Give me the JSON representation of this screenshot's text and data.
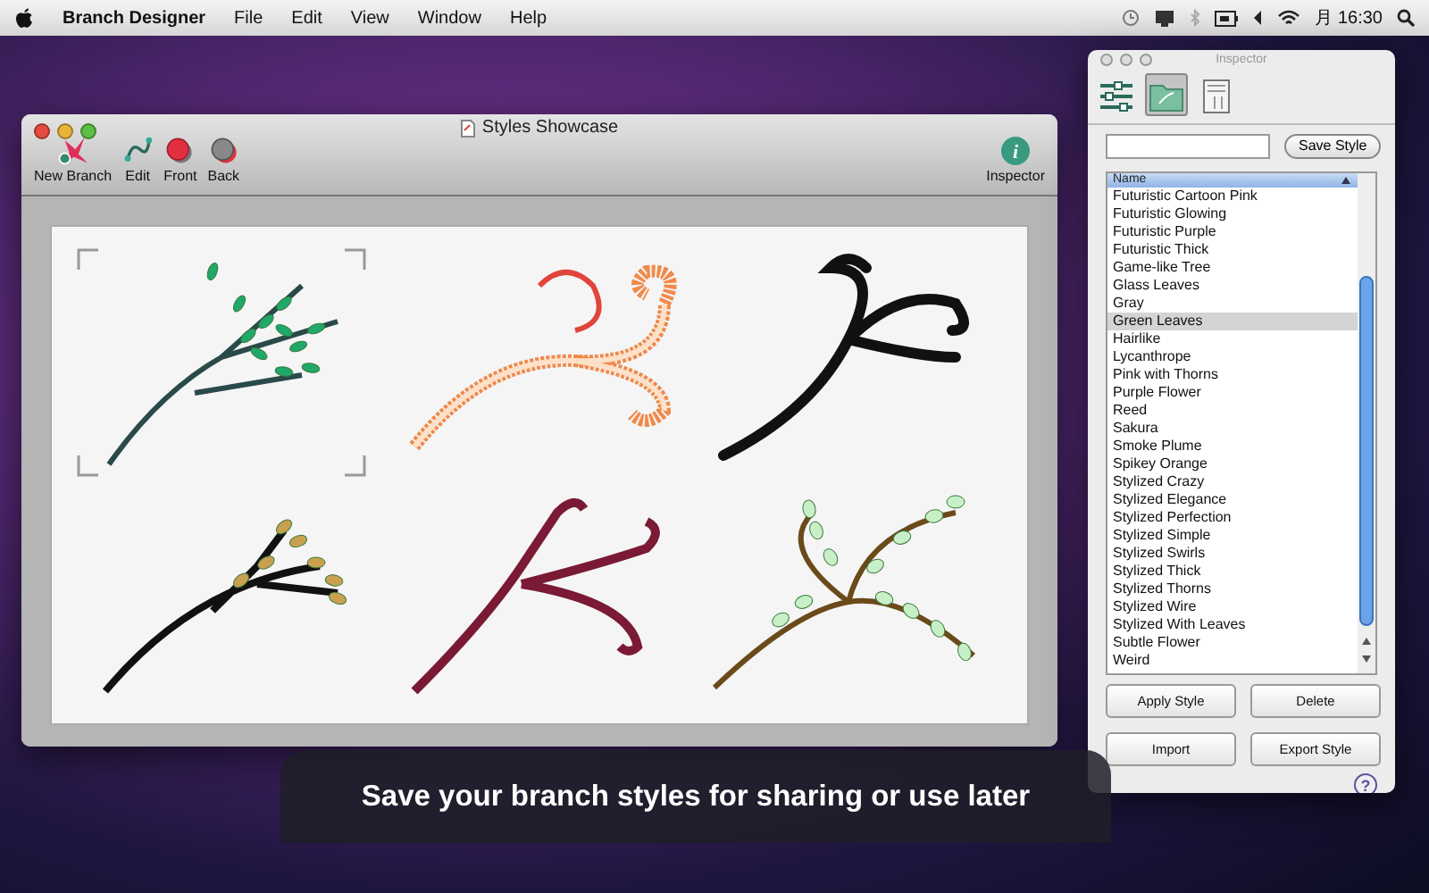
{
  "menu_bar": {
    "app_name": "Branch Designer",
    "menus": [
      "File",
      "Edit",
      "View",
      "Window",
      "Help"
    ],
    "clock": "月 16:30"
  },
  "document_window": {
    "title": "Styles Showcase",
    "toolbar": [
      {
        "label": "New Branch",
        "kind": "new"
      },
      {
        "label": "Edit",
        "kind": "edit"
      },
      {
        "label": "Front",
        "kind": "front"
      },
      {
        "label": "Back",
        "kind": "back"
      }
    ],
    "inspector_button": "Inspector",
    "inspector_icon_glyph": "i",
    "branches": [
      {
        "kind": "leafy",
        "color": "#1fa86a",
        "selected": true
      },
      {
        "kind": "flame",
        "color": "#f08a4a",
        "selected": false
      },
      {
        "kind": "curly",
        "color": "#111111",
        "selected": false
      },
      {
        "kind": "buds",
        "color": "#c8a050",
        "selected": false
      },
      {
        "kind": "thorny",
        "color": "#7a1a35",
        "selected": false
      },
      {
        "kind": "vine",
        "color": "#6b4a1a",
        "selected": false
      }
    ]
  },
  "inspector": {
    "title": "Inspector",
    "tabs": [
      {
        "kind": "sliders",
        "selected": false
      },
      {
        "kind": "folder",
        "selected": true
      },
      {
        "kind": "page",
        "selected": false
      }
    ],
    "save_button": "Save Style",
    "column_header": "Name",
    "styles": [
      {
        "name": "Futuristic Cartoon Pink",
        "selected": false
      },
      {
        "name": "Futuristic Glowing",
        "selected": false
      },
      {
        "name": "Futuristic Purple",
        "selected": false
      },
      {
        "name": "Futuristic Thick",
        "selected": false
      },
      {
        "name": "Game-like Tree",
        "selected": false
      },
      {
        "name": "Glass Leaves",
        "selected": false
      },
      {
        "name": "Gray",
        "selected": false
      },
      {
        "name": "Green Leaves",
        "selected": true
      },
      {
        "name": "Hairlike",
        "selected": false
      },
      {
        "name": "Lycanthrope",
        "selected": false
      },
      {
        "name": "Pink with Thorns",
        "selected": false
      },
      {
        "name": "Purple Flower",
        "selected": false
      },
      {
        "name": "Reed",
        "selected": false
      },
      {
        "name": "Sakura",
        "selected": false
      },
      {
        "name": "Smoke Plume",
        "selected": false
      },
      {
        "name": "Spikey Orange",
        "selected": false
      },
      {
        "name": "Stylized Crazy",
        "selected": false
      },
      {
        "name": "Stylized Elegance",
        "selected": false
      },
      {
        "name": "Stylized Perfection",
        "selected": false
      },
      {
        "name": "Stylized Simple",
        "selected": false
      },
      {
        "name": "Stylized Swirls",
        "selected": false
      },
      {
        "name": "Stylized Thick",
        "selected": false
      },
      {
        "name": "Stylized Thorns",
        "selected": false
      },
      {
        "name": "Stylized Wire",
        "selected": false
      },
      {
        "name": "Stylized With Leaves",
        "selected": false
      },
      {
        "name": "Subtle Flower",
        "selected": false
      },
      {
        "name": "Weird",
        "selected": false
      }
    ],
    "buttons": [
      "Apply Style",
      "Delete",
      "Import",
      "Export Style"
    ],
    "help_glyph": "?"
  },
  "caption": "Save your branch styles for sharing or use later"
}
